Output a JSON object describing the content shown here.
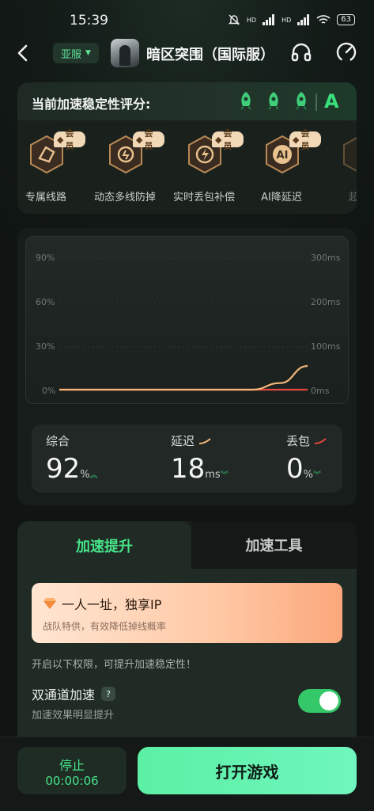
{
  "status_bar": {
    "time": "15:39",
    "network": "HD",
    "battery": "63"
  },
  "header": {
    "region": "亚服",
    "game_title": "暗区突围（国际服）"
  },
  "stability": {
    "title": "当前加速稳定性评分:",
    "grade": "A",
    "vip_badge": "会员",
    "features": [
      {
        "label": "专属线路",
        "icon": "route-icon"
      },
      {
        "label": "动态多线防掉",
        "icon": "multiline-icon"
      },
      {
        "label": "实时丢包补偿",
        "icon": "lightning-icon"
      },
      {
        "label": "AI降延迟",
        "icon": "ai-icon"
      },
      {
        "label": "超级",
        "icon": "extra-feature-icon"
      }
    ]
  },
  "chart_data": {
    "type": "line",
    "left_axis_ticks": [
      "90%",
      "60%",
      "30%",
      "0%"
    ],
    "right_axis_ticks": [
      "300ms",
      "200ms",
      "100ms",
      "0ms"
    ],
    "series": [
      {
        "values": [
          0,
          0,
          0,
          0,
          0,
          0,
          0,
          0,
          0,
          0
        ],
        "color": "#e5473f"
      },
      {
        "values": [
          0,
          0,
          0,
          0,
          0,
          0,
          0,
          0,
          5,
          18
        ],
        "color": "#f3b77a"
      }
    ]
  },
  "metrics": {
    "overall": {
      "label": "综合",
      "value": "92",
      "unit": "%"
    },
    "latency": {
      "label": "延迟",
      "value": "18",
      "unit": "ms"
    },
    "loss": {
      "label": "丢包",
      "value": "0",
      "unit": "%"
    }
  },
  "tabs": {
    "active": "加速提升",
    "inactive": "加速工具"
  },
  "promo": {
    "title": "一人一址，独享IP",
    "subtitle": "战队特供，有效降低掉线概率"
  },
  "hint": "开启以下权限，可提升加速稳定性！",
  "dual_channel": {
    "title": "双通道加速",
    "help": "?",
    "subtitle": "加速效果明显提升",
    "enabled": true
  },
  "bottom": {
    "stop_label": "停止",
    "timer": "00:00:06",
    "open_label": "打开游戏"
  },
  "colors": {
    "accent": "#47e48a",
    "toggle": "#34c869"
  }
}
